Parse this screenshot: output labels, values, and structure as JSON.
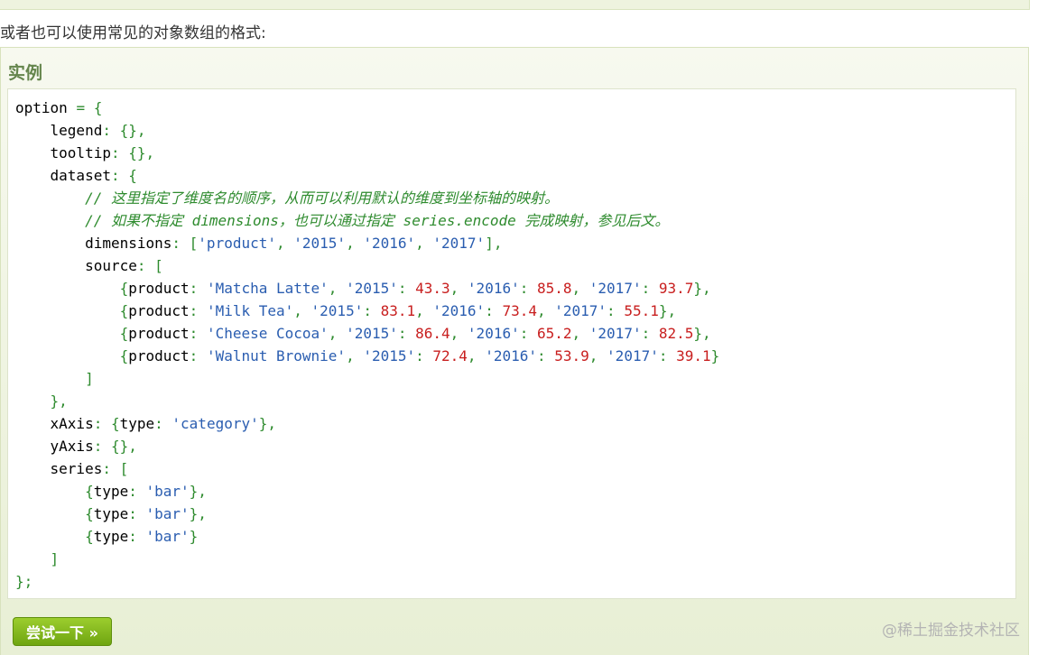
{
  "intro_text": "或者也可以使用常见的对象数组的格式:",
  "example": {
    "title": "实例",
    "code_lines": [
      [
        [
          "t",
          "option "
        ],
        [
          "p",
          "= {"
        ]
      ],
      [
        [
          "t",
          "    legend"
        ],
        [
          "p",
          ": {},"
        ]
      ],
      [
        [
          "t",
          "    tooltip"
        ],
        [
          "p",
          ": {},"
        ]
      ],
      [
        [
          "t",
          "    dataset"
        ],
        [
          "p",
          ": {"
        ]
      ],
      [
        [
          "c",
          "        // 这里指定了维度名的顺序，从而可以利用默认的维度到坐标轴的映射。"
        ]
      ],
      [
        [
          "c",
          "        // 如果不指定 dimensions，也可以通过指定 series.encode 完成映射，参见后文。"
        ]
      ],
      [
        [
          "t",
          "        dimensions"
        ],
        [
          "p",
          ": ["
        ],
        [
          "s",
          "'product'"
        ],
        [
          "p",
          ", "
        ],
        [
          "s",
          "'2015'"
        ],
        [
          "p",
          ", "
        ],
        [
          "s",
          "'2016'"
        ],
        [
          "p",
          ", "
        ],
        [
          "s",
          "'2017'"
        ],
        [
          "p",
          "],"
        ]
      ],
      [
        [
          "t",
          "        source"
        ],
        [
          "p",
          ": ["
        ]
      ],
      [
        [
          "p",
          "            {"
        ],
        [
          "t",
          "product"
        ],
        [
          "p",
          ": "
        ],
        [
          "s",
          "'Matcha Latte'"
        ],
        [
          "p",
          ", "
        ],
        [
          "s",
          "'2015'"
        ],
        [
          "p",
          ": "
        ],
        [
          "n",
          "43.3"
        ],
        [
          "p",
          ", "
        ],
        [
          "s",
          "'2016'"
        ],
        [
          "p",
          ": "
        ],
        [
          "n",
          "85.8"
        ],
        [
          "p",
          ", "
        ],
        [
          "s",
          "'2017'"
        ],
        [
          "p",
          ": "
        ],
        [
          "n",
          "93.7"
        ],
        [
          "p",
          "},"
        ]
      ],
      [
        [
          "p",
          "            {"
        ],
        [
          "t",
          "product"
        ],
        [
          "p",
          ": "
        ],
        [
          "s",
          "'Milk Tea'"
        ],
        [
          "p",
          ", "
        ],
        [
          "s",
          "'2015'"
        ],
        [
          "p",
          ": "
        ],
        [
          "n",
          "83.1"
        ],
        [
          "p",
          ", "
        ],
        [
          "s",
          "'2016'"
        ],
        [
          "p",
          ": "
        ],
        [
          "n",
          "73.4"
        ],
        [
          "p",
          ", "
        ],
        [
          "s",
          "'2017'"
        ],
        [
          "p",
          ": "
        ],
        [
          "n",
          "55.1"
        ],
        [
          "p",
          "},"
        ]
      ],
      [
        [
          "p",
          "            {"
        ],
        [
          "t",
          "product"
        ],
        [
          "p",
          ": "
        ],
        [
          "s",
          "'Cheese Cocoa'"
        ],
        [
          "p",
          ", "
        ],
        [
          "s",
          "'2015'"
        ],
        [
          "p",
          ": "
        ],
        [
          "n",
          "86.4"
        ],
        [
          "p",
          ", "
        ],
        [
          "s",
          "'2016'"
        ],
        [
          "p",
          ": "
        ],
        [
          "n",
          "65.2"
        ],
        [
          "p",
          ", "
        ],
        [
          "s",
          "'2017'"
        ],
        [
          "p",
          ": "
        ],
        [
          "n",
          "82.5"
        ],
        [
          "p",
          "},"
        ]
      ],
      [
        [
          "p",
          "            {"
        ],
        [
          "t",
          "product"
        ],
        [
          "p",
          ": "
        ],
        [
          "s",
          "'Walnut Brownie'"
        ],
        [
          "p",
          ", "
        ],
        [
          "s",
          "'2015'"
        ],
        [
          "p",
          ": "
        ],
        [
          "n",
          "72.4"
        ],
        [
          "p",
          ", "
        ],
        [
          "s",
          "'2016'"
        ],
        [
          "p",
          ": "
        ],
        [
          "n",
          "53.9"
        ],
        [
          "p",
          ", "
        ],
        [
          "s",
          "'2017'"
        ],
        [
          "p",
          ": "
        ],
        [
          "n",
          "39.1"
        ],
        [
          "p",
          "}"
        ]
      ],
      [
        [
          "p",
          "        ]"
        ]
      ],
      [
        [
          "p",
          "    },"
        ]
      ],
      [
        [
          "t",
          "    xAxis"
        ],
        [
          "p",
          ": {"
        ],
        [
          "t",
          "type"
        ],
        [
          "p",
          ": "
        ],
        [
          "s",
          "'category'"
        ],
        [
          "p",
          "},"
        ]
      ],
      [
        [
          "t",
          "    yAxis"
        ],
        [
          "p",
          ": {},"
        ]
      ],
      [
        [
          "t",
          "    series"
        ],
        [
          "p",
          ": ["
        ]
      ],
      [
        [
          "p",
          "        {"
        ],
        [
          "t",
          "type"
        ],
        [
          "p",
          ": "
        ],
        [
          "s",
          "'bar'"
        ],
        [
          "p",
          "},"
        ]
      ],
      [
        [
          "p",
          "        {"
        ],
        [
          "t",
          "type"
        ],
        [
          "p",
          ": "
        ],
        [
          "s",
          "'bar'"
        ],
        [
          "p",
          "},"
        ]
      ],
      [
        [
          "p",
          "        {"
        ],
        [
          "t",
          "type"
        ],
        [
          "p",
          ": "
        ],
        [
          "s",
          "'bar'"
        ],
        [
          "p",
          "}"
        ]
      ],
      [
        [
          "p",
          "    ]"
        ]
      ],
      [
        [
          "p",
          "};"
        ]
      ]
    ],
    "try_button_label": "尝试一下 »"
  },
  "watermark": "@稀土掘金技术社区",
  "colors": {
    "title_green": "#64854c",
    "button_green": "#7fb81e",
    "punctuation": "#2e8b2e",
    "string": "#2a5db0",
    "number": "#c81e1e",
    "comment": "#2e8b2e"
  }
}
